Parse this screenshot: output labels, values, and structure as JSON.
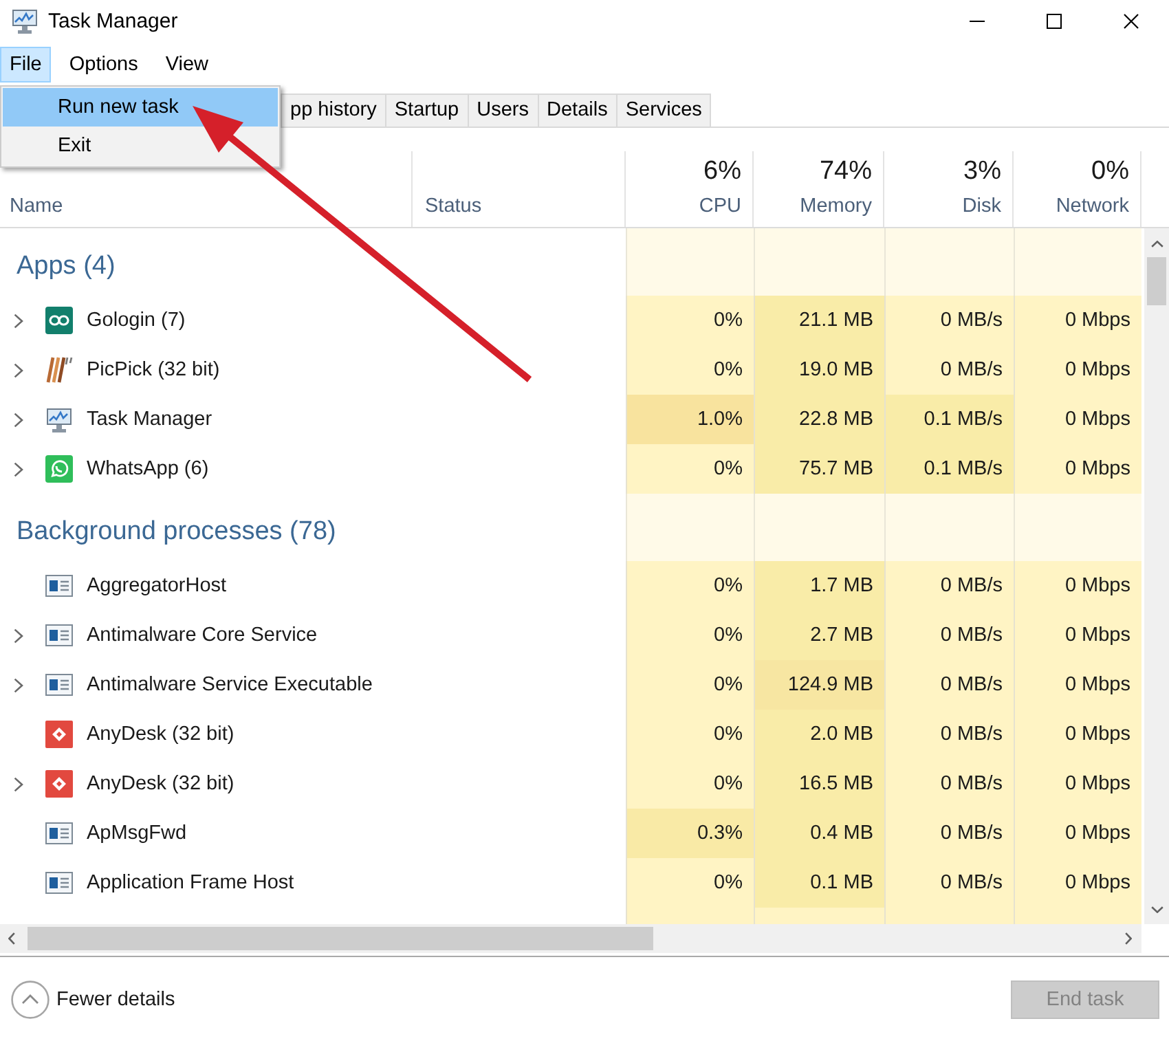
{
  "window": {
    "title": "Task Manager"
  },
  "menu": [
    {
      "label": "File",
      "selected": true
    },
    {
      "label": "Options",
      "selected": false
    },
    {
      "label": "View",
      "selected": false
    }
  ],
  "file_menu": {
    "items": [
      {
        "label": "Run new task",
        "selected": true
      },
      {
        "label": "Exit",
        "selected": false
      }
    ]
  },
  "tabs": [
    {
      "label": "pp history",
      "selected": false
    },
    {
      "label": "Startup",
      "selected": false
    },
    {
      "label": "Users",
      "selected": false
    },
    {
      "label": "Details",
      "selected": false
    },
    {
      "label": "Services",
      "selected": false
    }
  ],
  "table": {
    "columns": [
      {
        "label": "Name"
      },
      {
        "label": "Status"
      },
      {
        "percent": "6%",
        "label": "CPU"
      },
      {
        "percent": "74%",
        "label": "Memory"
      },
      {
        "percent": "3%",
        "label": "Disk"
      },
      {
        "percent": "0%",
        "label": "Network"
      }
    ],
    "groups": [
      {
        "title": "Apps (4)",
        "rows": [
          {
            "name": "Gologin (7)",
            "kind": "loop",
            "expandable": true,
            "cells": [
              {
                "text": "0%",
                "color": "#fff4c4"
              },
              {
                "text": "21.1 MB",
                "color": "#f9eca8"
              },
              {
                "text": "0 MB/s",
                "color": "#fff4c4"
              },
              {
                "text": "0 Mbps",
                "color": "#fff4c4"
              }
            ]
          },
          {
            "name": "PicPick (32 bit)",
            "kind": "stripes",
            "expandable": true,
            "cells": [
              {
                "text": "0%",
                "color": "#fff4c4"
              },
              {
                "text": "19.0 MB",
                "color": "#f9eca8"
              },
              {
                "text": "0 MB/s",
                "color": "#fff4c4"
              },
              {
                "text": "0 Mbps",
                "color": "#fff4c4"
              }
            ]
          },
          {
            "name": "Task Manager",
            "kind": "monitor",
            "expandable": true,
            "cells": [
              {
                "text": "1.0%",
                "color": "#f8e39e"
              },
              {
                "text": "22.8 MB",
                "color": "#f9eca8"
              },
              {
                "text": "0.1 MB/s",
                "color": "#f9eca8"
              },
              {
                "text": "0 Mbps",
                "color": "#fff4c4"
              }
            ]
          },
          {
            "name": "WhatsApp (6)",
            "kind": "chat",
            "expandable": true,
            "cells": [
              {
                "text": "0%",
                "color": "#fff4c4"
              },
              {
                "text": "75.7 MB",
                "color": "#f9eca8"
              },
              {
                "text": "0.1 MB/s",
                "color": "#f9eca8"
              },
              {
                "text": "0 Mbps",
                "color": "#fff4c4"
              }
            ]
          }
        ]
      },
      {
        "title": "Background processes (78)",
        "rows": [
          {
            "name": "AggregatorHost",
            "kind": "window",
            "expandable": false,
            "cells": [
              {
                "text": "0%",
                "color": "#fff4c4"
              },
              {
                "text": "1.7 MB",
                "color": "#f9eca8"
              },
              {
                "text": "0 MB/s",
                "color": "#fff4c4"
              },
              {
                "text": "0 Mbps",
                "color": "#fff4c4"
              }
            ]
          },
          {
            "name": "Antimalware Core Service",
            "kind": "window",
            "expandable": true,
            "cells": [
              {
                "text": "0%",
                "color": "#fff4c4"
              },
              {
                "text": "2.7 MB",
                "color": "#f9eca8"
              },
              {
                "text": "0 MB/s",
                "color": "#fff4c4"
              },
              {
                "text": "0 Mbps",
                "color": "#fff4c4"
              }
            ]
          },
          {
            "name": "Antimalware Service Executable",
            "kind": "window",
            "expandable": true,
            "cells": [
              {
                "text": "0%",
                "color": "#fff4c4"
              },
              {
                "text": "124.9 MB",
                "color": "#f7e6a2"
              },
              {
                "text": "0 MB/s",
                "color": "#fff4c4"
              },
              {
                "text": "0 Mbps",
                "color": "#fff4c4"
              }
            ]
          },
          {
            "name": "AnyDesk (32 bit)",
            "kind": "diamond",
            "expandable": false,
            "cells": [
              {
                "text": "0%",
                "color": "#fff4c4"
              },
              {
                "text": "2.0 MB",
                "color": "#f9eca8"
              },
              {
                "text": "0 MB/s",
                "color": "#fff4c4"
              },
              {
                "text": "0 Mbps",
                "color": "#fff4c4"
              }
            ]
          },
          {
            "name": "AnyDesk (32 bit)",
            "kind": "diamond",
            "expandable": true,
            "cells": [
              {
                "text": "0%",
                "color": "#fff4c4"
              },
              {
                "text": "16.5 MB",
                "color": "#f9eca8"
              },
              {
                "text": "0 MB/s",
                "color": "#fff4c4"
              },
              {
                "text": "0 Mbps",
                "color": "#fff4c4"
              }
            ]
          },
          {
            "name": "ApMsgFwd",
            "kind": "window",
            "expandable": false,
            "cells": [
              {
                "text": "0.3%",
                "color": "#f9eaa6"
              },
              {
                "text": "0.4 MB",
                "color": "#f9eca8"
              },
              {
                "text": "0 MB/s",
                "color": "#fff4c4"
              },
              {
                "text": "0 Mbps",
                "color": "#fff4c4"
              }
            ]
          },
          {
            "name": "Application Frame Host",
            "kind": "window",
            "expandable": false,
            "cells": [
              {
                "text": "0%",
                "color": "#fff4c4"
              },
              {
                "text": "0.1 MB",
                "color": "#f9eca8"
              },
              {
                "text": "0 MB/s",
                "color": "#fff4c4"
              },
              {
                "text": "0 Mbps",
                "color": "#fff4c4"
              }
            ]
          }
        ]
      }
    ]
  },
  "footer": {
    "toggle": "Fewer details",
    "end_task": {
      "label": "End task",
      "disabled": true
    }
  }
}
